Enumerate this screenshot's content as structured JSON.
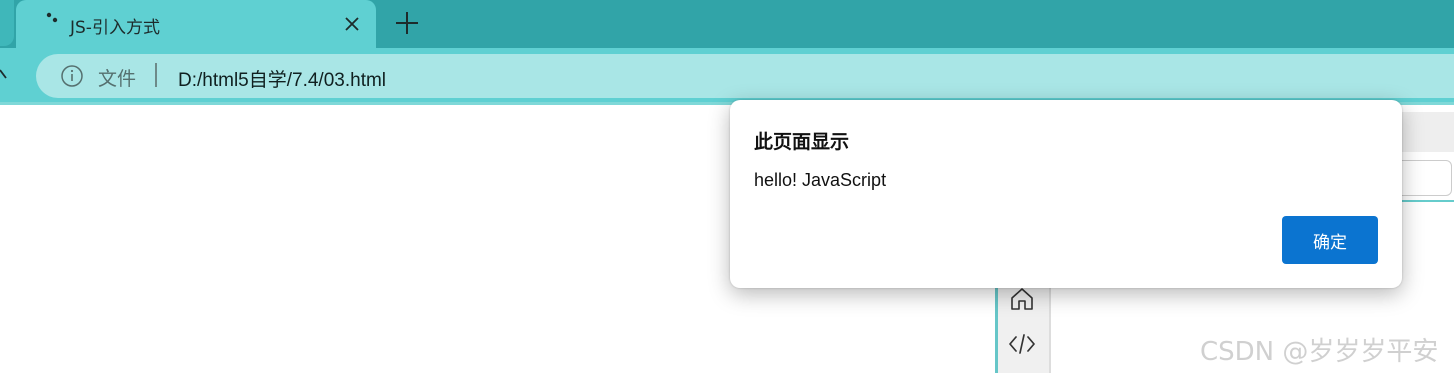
{
  "browser": {
    "tab": {
      "title": "JS-引入方式",
      "icon": "loading-dots-icon",
      "close_icon": "close-icon"
    },
    "new_tab_icon": "plus-icon",
    "address_bar": {
      "security_icon": "info-icon",
      "scheme_label": "文件",
      "url": "D:/html5自学/7.4/03.html"
    }
  },
  "dialog": {
    "title": "此页面显示",
    "message": "hello! JavaScript",
    "ok_label": "确定"
  },
  "side_panel": {
    "icons": [
      "home-icon",
      "code-icon"
    ]
  },
  "watermark": "CSDN @岁岁岁平安",
  "colors": {
    "tabstrip": "#31a4a8",
    "active_tab": "#5fd0d2",
    "omnibox": "#a9e6e6",
    "ok_button": "#0b74d0"
  }
}
